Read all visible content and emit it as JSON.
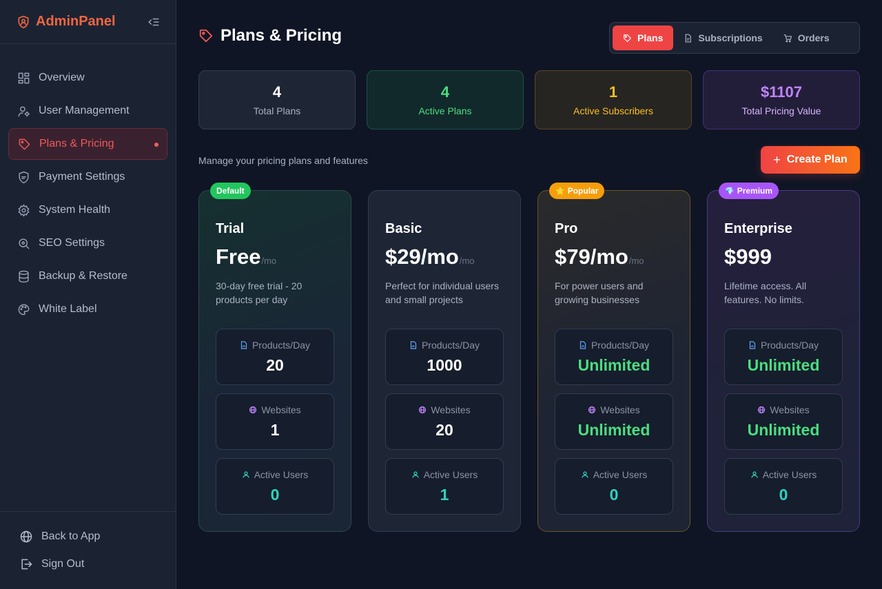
{
  "brand": {
    "name": "AdminPanel"
  },
  "sidebar": {
    "items": [
      {
        "label": "Overview",
        "icon": "dashboard-icon"
      },
      {
        "label": "User Management",
        "icon": "user-gear-icon"
      },
      {
        "label": "Plans & Pricing",
        "icon": "tag-icon",
        "active": true
      },
      {
        "label": "Payment Settings",
        "icon": "shield-icon"
      },
      {
        "label": "System Health",
        "icon": "gear-icon"
      },
      {
        "label": "SEO Settings",
        "icon": "search-icon"
      },
      {
        "label": "Backup & Restore",
        "icon": "database-icon"
      },
      {
        "label": "White Label",
        "icon": "palette-icon"
      }
    ],
    "bottom": [
      {
        "label": "Back to App",
        "icon": "globe-icon"
      },
      {
        "label": "Sign Out",
        "icon": "sign-out-icon"
      }
    ]
  },
  "header": {
    "title": "Plans & Pricing"
  },
  "tabs": [
    {
      "label": "Plans",
      "active": true
    },
    {
      "label": "Subscriptions"
    },
    {
      "label": "Orders"
    }
  ],
  "stats": [
    {
      "value": "4",
      "label": "Total Plans"
    },
    {
      "value": "4",
      "label": "Active Plans"
    },
    {
      "value": "1",
      "label": "Active Subscribers"
    },
    {
      "value": "$1107",
      "label": "Total Pricing Value"
    }
  ],
  "subtitle": "Manage your pricing plans and features",
  "create_button": {
    "label": "Create Plan"
  },
  "feature_labels": {
    "products": "Products/Day",
    "websites": "Websites",
    "users": "Active Users"
  },
  "plans": [
    {
      "badge": "Default",
      "name": "Trial",
      "price": "Free",
      "period": "/mo",
      "description": "30-day free trial - 20 products per day",
      "products": "20",
      "websites": "1",
      "users": "0"
    },
    {
      "name": "Basic",
      "price": "$29/mo",
      "period": "/mo",
      "description": "Perfect for individual users and small projects",
      "products": "1000",
      "websites": "20",
      "users": "1"
    },
    {
      "badge": "Popular",
      "name": "Pro",
      "price": "$79/mo",
      "period": "/mo",
      "description": "For power users and growing businesses",
      "products": "Unlimited",
      "websites": "Unlimited",
      "users": "0"
    },
    {
      "badge": "Premium",
      "name": "Enterprise",
      "price": "$999",
      "period": "",
      "description": "Lifetime access. All features. No limits.",
      "products": "Unlimited",
      "websites": "Unlimited",
      "users": "0"
    }
  ],
  "colors": {
    "accent": "#ef4444",
    "brand": "#f0663f",
    "green": "#4ade80",
    "teal": "#2dd4bf",
    "amber": "#fbbf24",
    "purple": "#c084fc"
  }
}
